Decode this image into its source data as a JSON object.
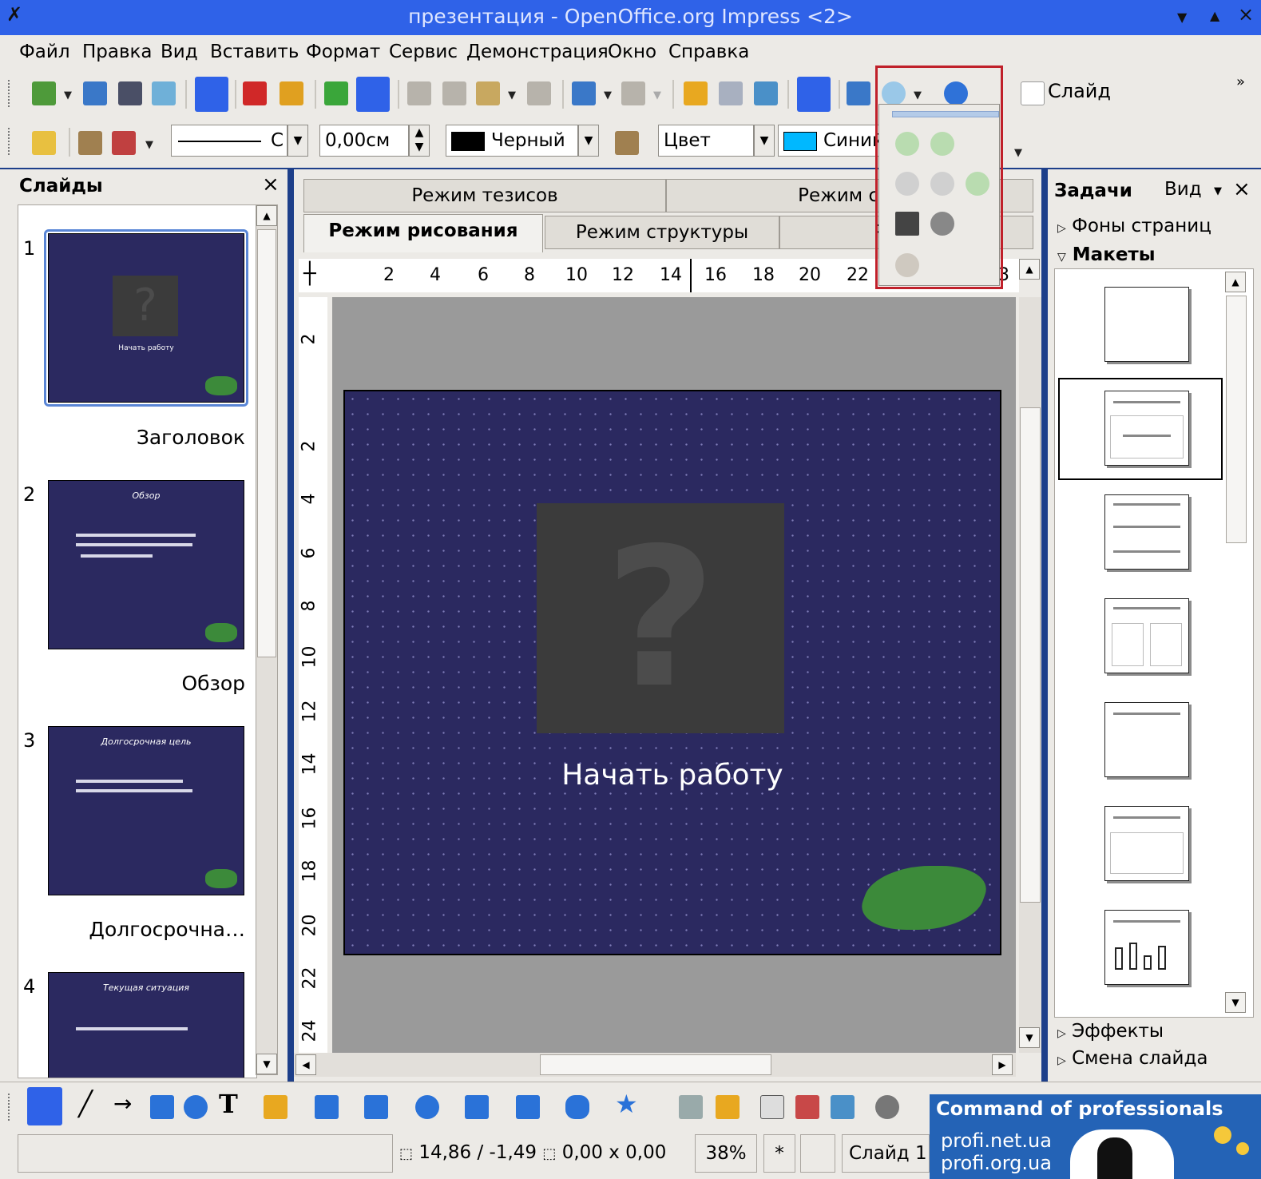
{
  "window": {
    "title": "презентация - OpenOffice.org Impress <2>"
  },
  "menu": [
    "Файл",
    "Правка",
    "Вид",
    "Вставить",
    "Формат",
    "Сервис",
    "Демонстрация",
    "Окно",
    "Справка"
  ],
  "toolbar": {
    "slide_label": "Слайд"
  },
  "line_style": {
    "value": "С"
  },
  "line_width": {
    "value": "0,00см"
  },
  "line_color": {
    "value": "Черный",
    "swatch": "#000000"
  },
  "area_style": {
    "value": "Цвет"
  },
  "area_color": {
    "value": "Синий",
    "swatch": "#00b8ff"
  },
  "slides_pane": {
    "title": "Слайды",
    "close": "×",
    "slides": [
      {
        "number": "1",
        "label": "Заголовок",
        "thumb_title": "",
        "thumb_text": "Начать работу"
      },
      {
        "number": "2",
        "label": "Обзор",
        "thumb_title": "Обзор"
      },
      {
        "number": "3",
        "label": "Долгосрочна…",
        "thumb_title": "Долгосрочная цель"
      },
      {
        "number": "4",
        "label": "",
        "thumb_title": "Текущая ситуация"
      }
    ]
  },
  "editor": {
    "tabs_top": [
      "Режим тезисов",
      "Режим сла"
    ],
    "tabs_bottom": [
      "Режим рисования",
      "Режим структуры",
      "Режим"
    ],
    "ruler_h": [
      "2",
      "4",
      "6",
      "8",
      "10",
      "12",
      "14",
      "16",
      "18",
      "20",
      "22",
      "3"
    ],
    "ruler_v": [
      "2",
      "2",
      "4",
      "6",
      "8",
      "10",
      "12",
      "14",
      "16",
      "18",
      "20",
      "22",
      "24"
    ],
    "slide_text": "Начать работу",
    "placeholder": "?"
  },
  "tasks": {
    "title": "Задачи",
    "view": "Вид",
    "sections": {
      "backgrounds": "Фоны страниц",
      "layouts": "Макеты",
      "effects": "Эффекты",
      "transition": "Смена слайда"
    }
  },
  "status": {
    "position": "14,86 / -1,49",
    "size": "0,00 x 0,00",
    "zoom": "38%",
    "modified": "*",
    "slide": "Слайд 1"
  },
  "watermark": {
    "line1": "Command of professionals",
    "line2": "profi.net.ua",
    "line3": "profi.org.ua"
  },
  "colors": {
    "title_bar": "#2f62e8",
    "slide_bg": "#2b2960",
    "highlight": "#c0202a"
  }
}
